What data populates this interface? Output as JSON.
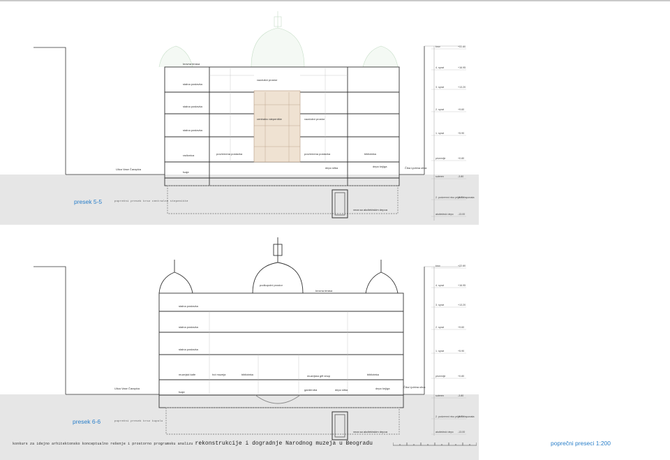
{
  "footer": {
    "prefix": "konkurs za idejno arhitektonsko konceptualno rešenje i prostorno programsku analizu",
    "main": "rekonstrukcije i dogradnje Narodnog muzeja u Beogradu"
  },
  "sheet_title": "poprečni preseci 1:200",
  "section1": {
    "title": "presek 5-5",
    "subtitle": "poprečni presek kroz centralno stepenište",
    "labels": {
      "krovna_terasa": "krovna terasa",
      "vazdusni1": "vazdušni prostor",
      "vazdusni2": "vazdušni prostor",
      "stalna1": "stalna postavka",
      "stalna2": "stalna postavka",
      "stalna3": "stalna postavka",
      "centralno": "centralno stepenište",
      "radionica": "radionica",
      "povremena1": "povremena postavka",
      "povremena2": "povremena postavka",
      "biblioteka": "biblioteka",
      "depo_slika": "depo slika",
      "depo_knjiga": "depo knjiga",
      "foaje": "foaje",
      "street_left": "Ulica Vase Čarapića",
      "street_right": "Čika Ljubina ulica",
      "veza": "veza sa akcitektskim depoa"
    }
  },
  "section2": {
    "title": "presek 6-6",
    "subtitle": "poprečni presek kroz kupolu",
    "labels": {
      "podkupolni": "podkupolni prostor",
      "krovna_terasa": "krovna terasa",
      "stalna1": "stalna postavka",
      "stalna2": "stalna postavka",
      "stalna3": "stalna postavka",
      "muzejski_kafe": "muzejski kafe",
      "hol": "hol muzeja",
      "biblioteka_top": "biblioteka",
      "prodavnica": "muzejska gift shop",
      "biblioteka": "biblioteka",
      "depo_knjiga": "depo knjiga",
      "depo_slika": "depo slika",
      "garderoba": "garderoba",
      "foaje": "foaje",
      "street_left": "Ulica Vase Čarapića",
      "street_right": "Čika Ljubina ulica",
      "veza": "veza sa akcitektskim depoa"
    }
  },
  "levels": {
    "names": [
      "krov",
      "4. sprat",
      "3. sprat",
      "2. sprat",
      "1. sprat",
      "prizemlje",
      "suteren",
      "2. podzemni nivo prijem eksponata",
      "akcitektski depo"
    ],
    "s1": [
      "+22.80",
      "+16.95",
      "+13.20",
      "+9.60",
      "+5.90",
      "+0.80",
      "-3.80",
      "-8.70",
      "-13.00"
    ],
    "s2": [
      "+22.80",
      "+16.95",
      "+13.20",
      "+9.60",
      "+5.90",
      "+0.80",
      "-3.80",
      "-8.70",
      "-13.00"
    ]
  }
}
